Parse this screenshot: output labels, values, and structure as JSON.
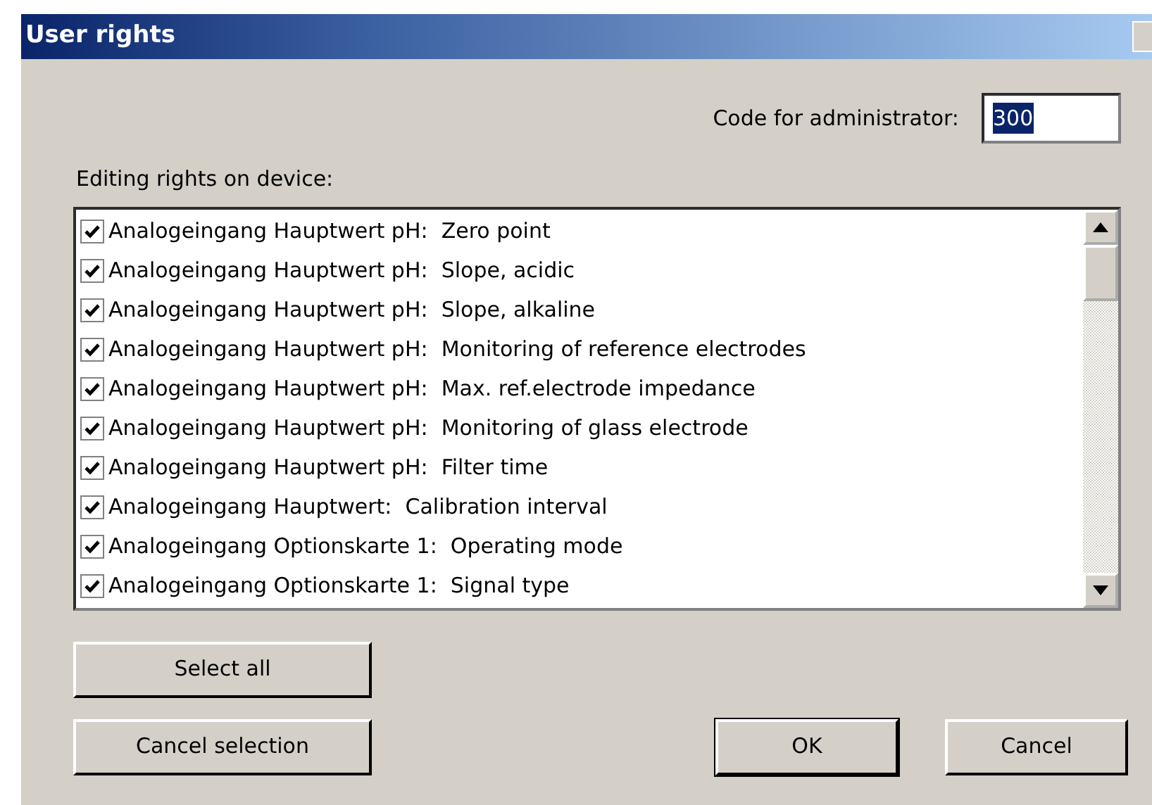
{
  "window": {
    "title": "User rights"
  },
  "admin_code": {
    "label": "Code for administrator:",
    "value": "300",
    "selected": true
  },
  "rights": {
    "label": "Editing rights on device:",
    "items": [
      {
        "text": "Analogeingang Hauptwert pH:  Zero point",
        "checked": true
      },
      {
        "text": "Analogeingang Hauptwert pH:  Slope, acidic",
        "checked": true
      },
      {
        "text": "Analogeingang Hauptwert pH:  Slope, alkaline",
        "checked": true
      },
      {
        "text": "Analogeingang Hauptwert pH:  Monitoring of reference electrodes",
        "checked": true
      },
      {
        "text": "Analogeingang Hauptwert pH:  Max. ref.electrode impedance",
        "checked": true
      },
      {
        "text": "Analogeingang Hauptwert pH:  Monitoring of glass electrode",
        "checked": true
      },
      {
        "text": "Analogeingang Hauptwert pH:  Filter time",
        "checked": true
      },
      {
        "text": "Analogeingang Hauptwert:  Calibration interval",
        "checked": true
      },
      {
        "text": "Analogeingang Optionskarte 1:  Operating mode",
        "checked": true
      },
      {
        "text": "Analogeingang Optionskarte 1:  Signal type",
        "checked": true
      }
    ]
  },
  "buttons": {
    "select_all": "Select all",
    "cancel_selection": "Cancel selection",
    "ok": "OK",
    "cancel": "Cancel"
  }
}
